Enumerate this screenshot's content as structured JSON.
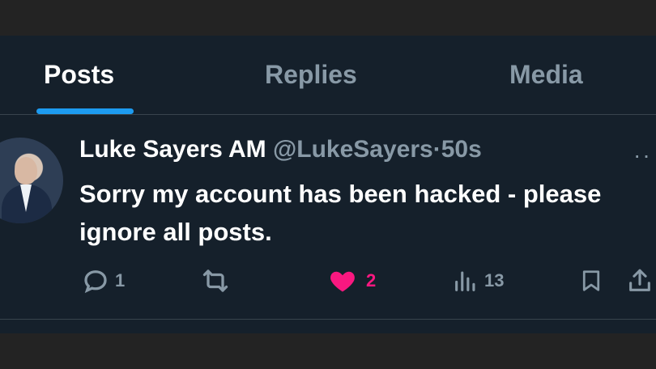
{
  "tabs": [
    {
      "label": "Posts",
      "active": true
    },
    {
      "label": "Replies",
      "active": false
    },
    {
      "label": "Media",
      "active": false
    }
  ],
  "tweet": {
    "author_name": "Luke Sayers AM",
    "handle": "@LukeSayers",
    "separator": "·",
    "time": "50s",
    "text": "Sorry my account has been hacked - please ignore all posts.",
    "actions": {
      "reply": {
        "icon": "reply-icon",
        "count": "1"
      },
      "repost": {
        "icon": "repost-icon",
        "count": ""
      },
      "like": {
        "icon": "heart-icon",
        "count": "2",
        "liked": true
      },
      "views": {
        "icon": "views-icon",
        "count": "13"
      },
      "bookmark": {
        "icon": "bookmark-icon"
      },
      "share": {
        "icon": "share-icon"
      }
    }
  },
  "colors": {
    "background": "#15202b",
    "accent": "#1d9bf0",
    "like": "#f91880",
    "muted": "#8899a6",
    "text": "#ffffff"
  }
}
